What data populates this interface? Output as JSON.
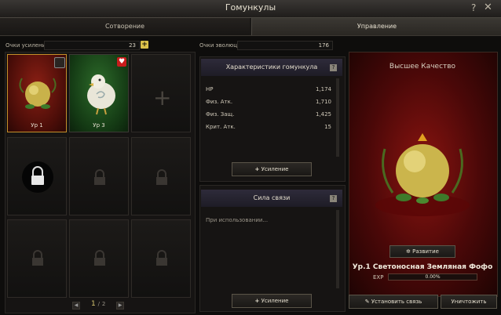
{
  "window": {
    "title": "Гомункулы",
    "help": "?",
    "close": "✕"
  },
  "tabs": [
    {
      "label": "Сотворение"
    },
    {
      "label": "Управление"
    }
  ],
  "points": {
    "boost_label": "Очки усиления",
    "boost_value": "23",
    "evolution_label": "Очки эволюции",
    "evolution_value": "176"
  },
  "slots": [
    {
      "level": "Ур 1",
      "state": "filled",
      "bg": "red",
      "favorite": false
    },
    {
      "level": "Ур 3",
      "state": "filled",
      "bg": "green",
      "favorite": true
    },
    {
      "state": "add"
    },
    {
      "state": "locked"
    },
    {
      "state": "locked-dim"
    },
    {
      "state": "locked-dim"
    },
    {
      "state": "locked-dim"
    },
    {
      "state": "locked-dim"
    },
    {
      "state": "locked-dim"
    }
  ],
  "pager": {
    "current": "1",
    "separator": "/",
    "total": "2"
  },
  "stats_panel": {
    "title": "Характеристики гомункула",
    "rows": [
      {
        "name": "HP",
        "value": "1,174"
      },
      {
        "name": "Физ. Атк.",
        "value": "1,710"
      },
      {
        "name": "Физ. Защ.",
        "value": "1,425"
      },
      {
        "name": "Крит. Атк.",
        "value": "15"
      }
    ],
    "button": "Усиление"
  },
  "bond_panel": {
    "title": "Сила связи",
    "text": "При использовании...",
    "button": "Усиление"
  },
  "preview": {
    "quality": "Высшее Качество",
    "develop_button": "Развитие",
    "name": "Ур.1 Светоносная Земляная Фофо",
    "exp_label": "EXP",
    "exp_value": "0.00%",
    "exp_fraction": 0
  },
  "actions": {
    "bind": "Установить связь",
    "destroy": "Уничтожить"
  },
  "colors": {
    "accent_gold": "#d9c04a",
    "quality_red": "#8a1410"
  }
}
